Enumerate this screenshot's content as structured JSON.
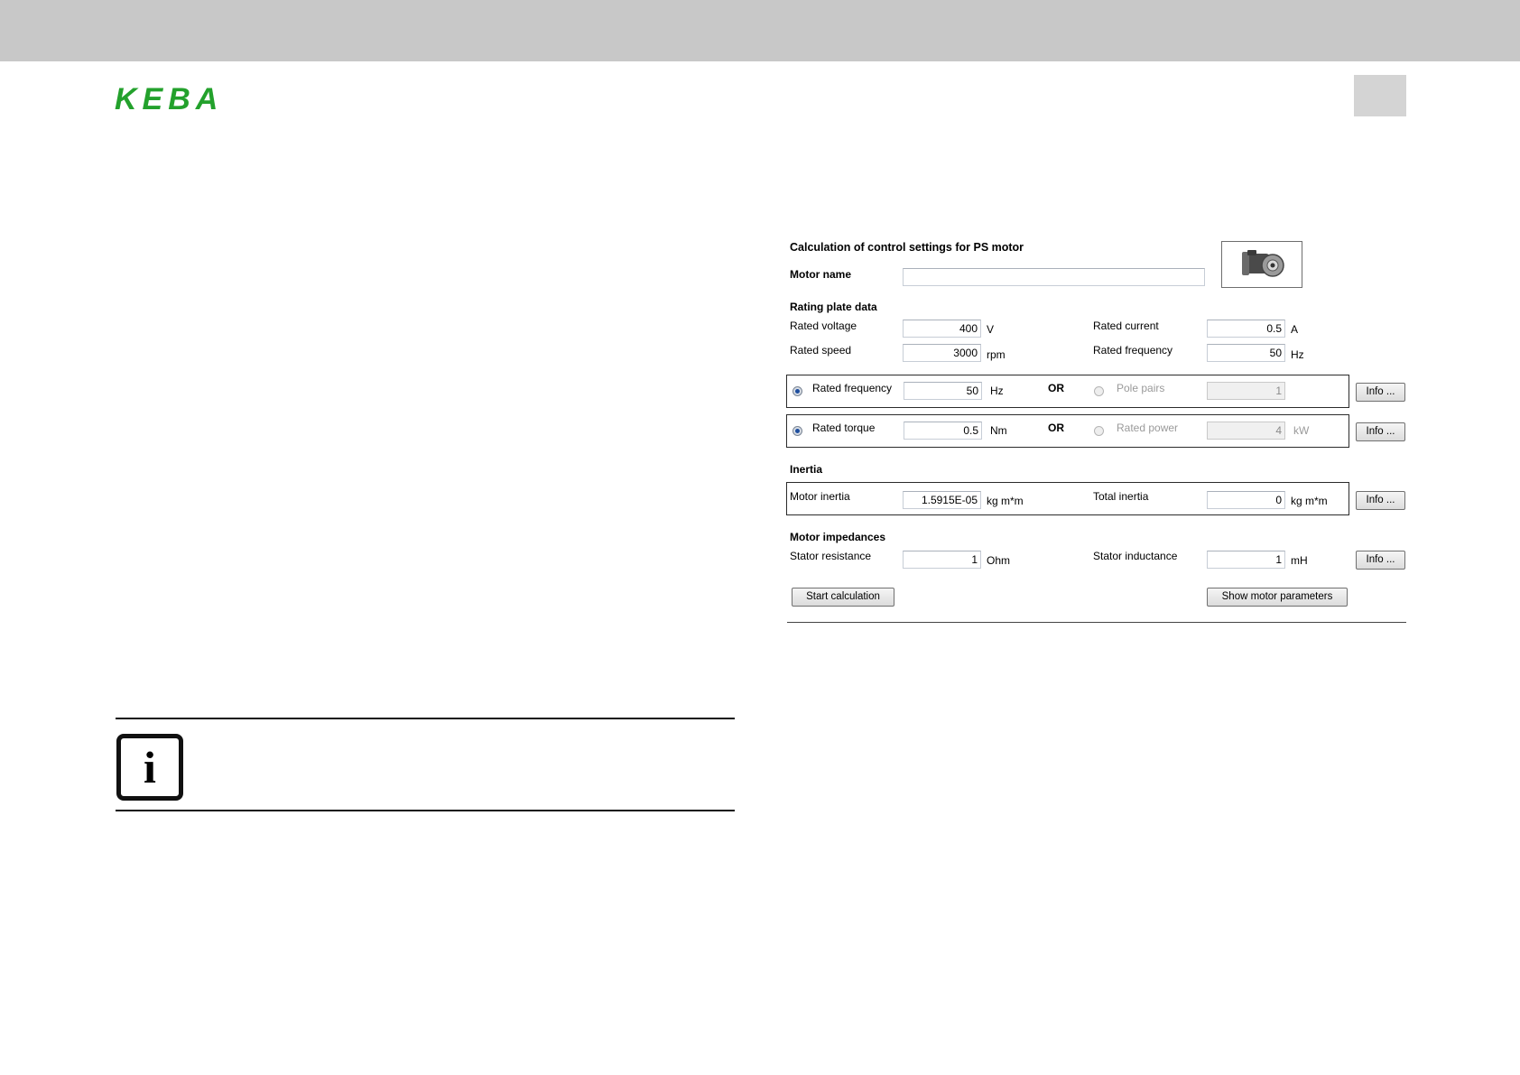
{
  "brand": {
    "logo_text": "KEBA",
    "accent": "#23a12c"
  },
  "dialog": {
    "title": "Calculation of control settings for PS motor",
    "motor_name_label": "Motor name",
    "motor_name_value": "",
    "motor_image_icon": "motor-icon",
    "rating_plate": {
      "heading": "Rating plate data",
      "rated_voltage": {
        "label": "Rated voltage",
        "value": "400",
        "unit": "V"
      },
      "rated_speed": {
        "label": "Rated speed",
        "value": "3000",
        "unit": "rpm"
      },
      "rated_current": {
        "label": "Rated current",
        "value": "0.5",
        "unit": "A"
      },
      "rated_frequency": {
        "label": "Rated frequency",
        "value": "50",
        "unit": "Hz"
      }
    },
    "option_group_1": {
      "option_a": {
        "label": "Rated frequency",
        "value": "50",
        "unit": "Hz",
        "selected": true
      },
      "or_label": "OR",
      "option_b": {
        "label": "Pole pairs",
        "value": "1",
        "unit": "",
        "selected": false
      },
      "info_button": "Info ..."
    },
    "option_group_2": {
      "option_a": {
        "label": "Rated torque",
        "value": "0.5",
        "unit": "Nm",
        "selected": true
      },
      "or_label": "OR",
      "option_b": {
        "label": "Rated power",
        "value": "4",
        "unit": "kW",
        "selected": false
      },
      "info_button": "Info ..."
    },
    "inertia": {
      "heading": "Inertia",
      "motor_inertia": {
        "label": "Motor inertia",
        "value": "1.5915E-05",
        "unit": "kg m*m"
      },
      "total_inertia": {
        "label": "Total inertia",
        "value": "0",
        "unit": "kg m*m"
      },
      "info_button": "Info ..."
    },
    "impedances": {
      "heading": "Motor impedances",
      "stator_resistance": {
        "label": "Stator resistance",
        "value": "1",
        "unit": "Ohm"
      },
      "stator_inductance": {
        "label": "Stator inductance",
        "value": "1",
        "unit": "mH"
      },
      "info_button": "Info ..."
    },
    "start_button": "Start calculation",
    "show_params_button": "Show motor parameters"
  },
  "info_note": {
    "icon": "info-icon",
    "symbol": "i"
  }
}
